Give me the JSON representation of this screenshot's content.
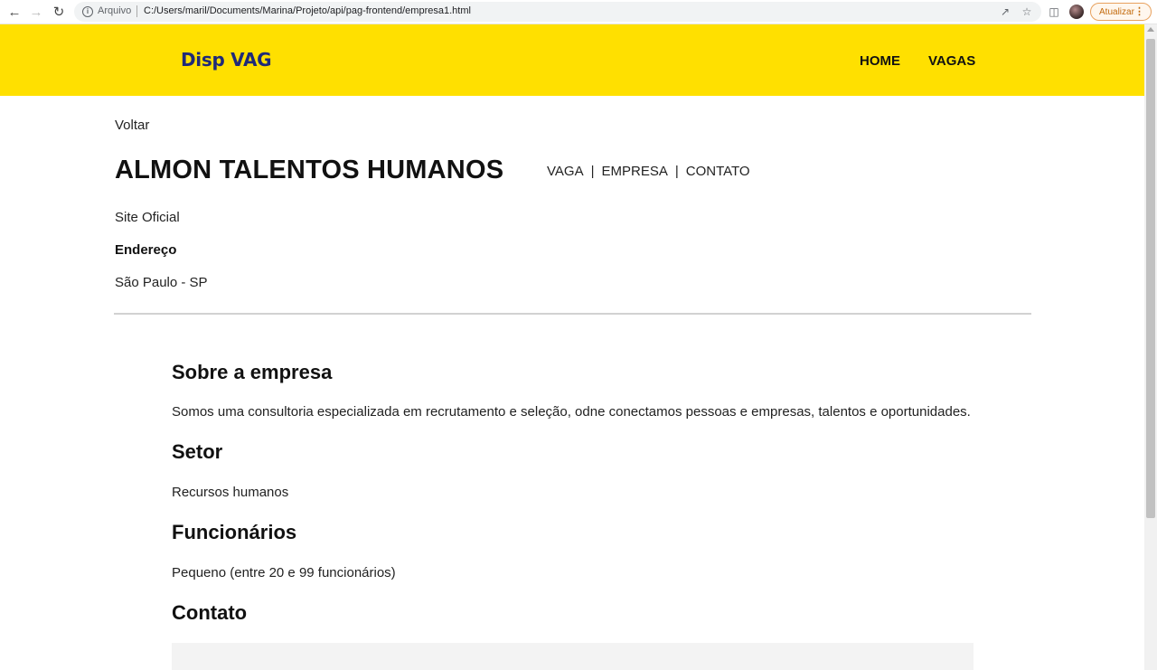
{
  "browser": {
    "scheme_label": "Arquivo",
    "url": "C:/Users/maril/Documents/Marina/Projeto/api/pag-frontend/empresa1.html",
    "update_label": "Atualizar"
  },
  "header": {
    "logo": "Disp VAG",
    "nav": [
      {
        "label": "HOME"
      },
      {
        "label": "VAGAS"
      }
    ]
  },
  "page": {
    "back_label": "Voltar",
    "company_name": "ALMON TALENTOS HUMANOS",
    "subnav": [
      {
        "label": "VAGA"
      },
      {
        "label": "EMPRESA"
      },
      {
        "label": "CONTATO"
      }
    ],
    "subnav_divider": "|",
    "site_link": "Site Oficial",
    "address_label": "Endereço",
    "address_value": "São Paulo - SP"
  },
  "sections": {
    "about_title": "Sobre a empresa",
    "about_text": "Somos uma consultoria especializada em recrutamento e seleção, odne conectamos pessoas e empresas, talentos e oportunidades.",
    "sector_title": "Setor",
    "sector_text": "Recursos humanos",
    "employees_title": "Funcionários",
    "employees_text": "Pequeno (entre 20 e 99 funcionários)",
    "contact_title": "Contato"
  },
  "colors": {
    "header_bg": "#ffe000",
    "logo": "#1f2a78"
  }
}
